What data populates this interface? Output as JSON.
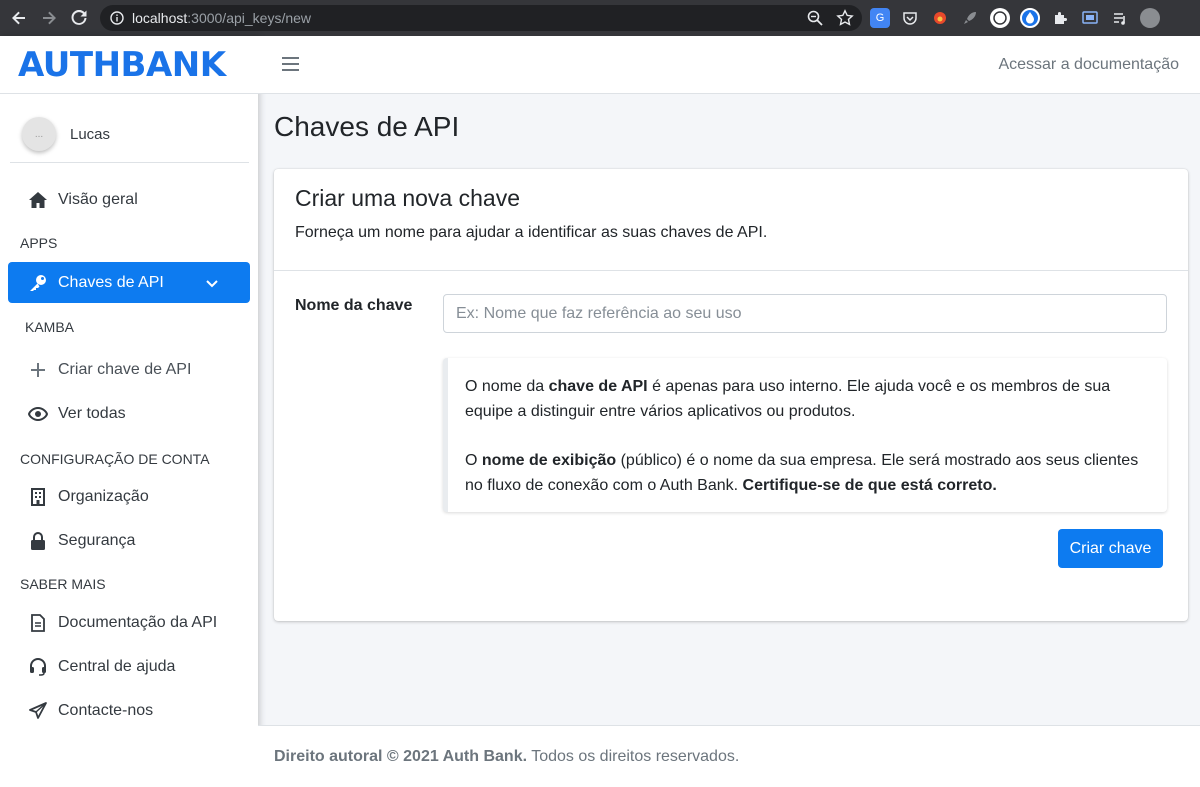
{
  "browser": {
    "url_host": "localhost",
    "url_path": ":3000/api_keys/new"
  },
  "brand": {
    "logo_text": "AUTHBANK",
    "color": "#1a73e8"
  },
  "user": {
    "name": "Lucas",
    "avatar_text": "..."
  },
  "sidebar": {
    "overview": "Visão geral",
    "headers": {
      "apps": "APPS",
      "kamba": "KAMBA",
      "account": "CONFIGURAÇÃO DE CONTA",
      "learn": "SABER MAIS"
    },
    "api_keys": "Chaves de API",
    "create_key": "Criar chave de API",
    "view_all": "Ver todas",
    "organization": "Organização",
    "security": "Segurança",
    "api_docs": "Documentação da API",
    "help_center": "Central de ajuda",
    "contact": "Contacte-nos"
  },
  "topbar": {
    "doc_link": "Acessar a documentação"
  },
  "page": {
    "title": "Chaves de API"
  },
  "card": {
    "title": "Criar uma nova chave",
    "subtitle": "Forneça um nome para ajudar a identificar as suas chaves de API.",
    "field_label": "Nome da chave",
    "field_placeholder": "Ex: Nome que faz referência ao seu uso",
    "field_value": "",
    "callout": {
      "p1_a": "O nome da ",
      "p1_b": "chave de API",
      "p1_c": " é apenas para uso interno. Ele ajuda você e os membros de sua equipe a distinguir entre vários aplicativos ou produtos.",
      "p2_a": "O ",
      "p2_b": "nome de exibição",
      "p2_c": " (público) é o nome da sua empresa. Ele será mostrado aos seus clientes no fluxo de conexão com o Auth Bank. ",
      "p2_d": "Certifique-se de que está correto."
    },
    "submit": "Criar chave"
  },
  "footer": {
    "bold": "Direito autoral © 2021 Auth Bank.",
    "rest": " Todos os direitos reservados."
  },
  "colors": {
    "primary": "#0d7bf0",
    "brand": "#1a73e8"
  }
}
